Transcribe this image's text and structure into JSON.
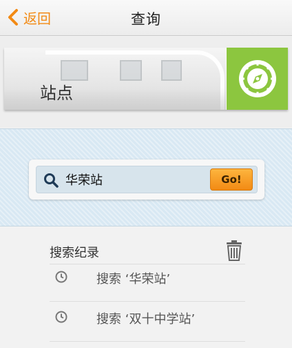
{
  "navbar": {
    "back_label": "返回",
    "title": "查询"
  },
  "banner": {
    "label": "站点",
    "icon": "compass-icon",
    "accent": "#8cc63f"
  },
  "search": {
    "value": "华荣站",
    "button_label": "Go!",
    "button_color": "#f28a14"
  },
  "history": {
    "title": "搜索纪录",
    "items": [
      {
        "label": "搜索 ‘华荣站’"
      },
      {
        "label": "搜索 ‘双十中学站’"
      }
    ]
  },
  "colors": {
    "accent_orange": "#f28a14",
    "search_bg": "#d8e8f3"
  }
}
